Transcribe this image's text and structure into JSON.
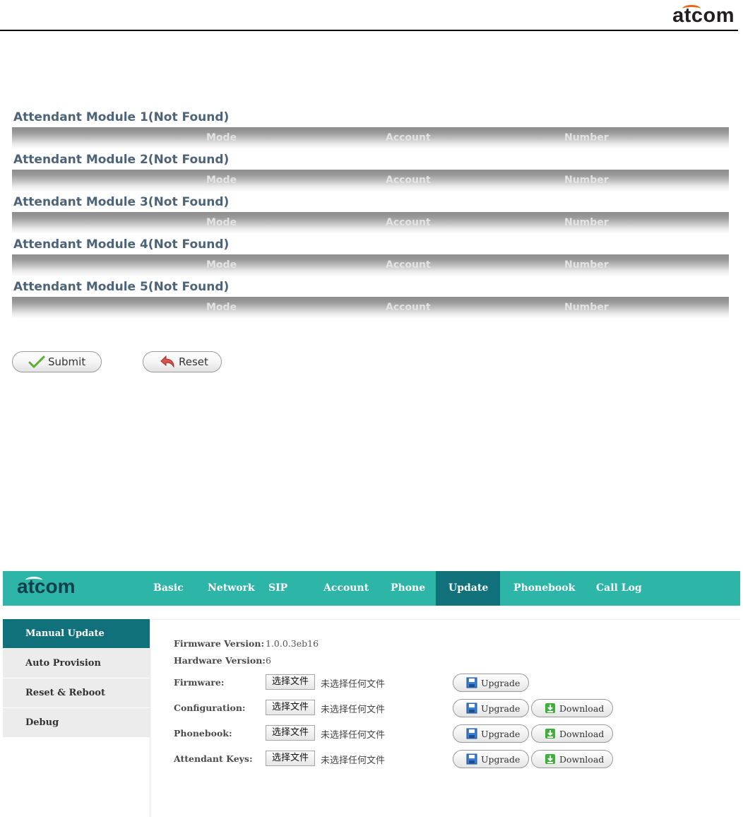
{
  "document": {
    "logo": "atcom"
  },
  "modules": [
    {
      "title": "Attendant Module 1(Not Found)"
    },
    {
      "title": "Attendant Module 2(Not Found)"
    },
    {
      "title": "Attendant Module 3(Not Found)"
    },
    {
      "title": "Attendant Module 4(Not Found)"
    },
    {
      "title": "Attendant Module 5(Not Found)"
    }
  ],
  "module_columns": {
    "mode": "Mode",
    "account": "Account",
    "number": "Number"
  },
  "form_buttons": {
    "submit": "Submit",
    "reset": "Reset"
  },
  "ui": {
    "logo": "atcom",
    "nav": [
      "Basic",
      "Network",
      "SIP",
      "Account",
      "Phone",
      "Update",
      "Phonebook",
      "Call Log"
    ],
    "active_nav": "Update",
    "sidebar": [
      "Manual Update",
      "Auto Provision",
      "Reset & Reboot",
      "Debug"
    ],
    "active_sidebar": "Manual Update",
    "firmware_version_label": "Firmware Version:",
    "firmware_version_value": "1.0.0.3eb16",
    "hardware_version_label": "Hardware Version:",
    "hardware_version_value": "6",
    "rows": [
      {
        "label": "Firmware:",
        "choose": "选择文件",
        "nofile": "未选择任何文件",
        "upgrade": "Upgrade"
      },
      {
        "label": "Configuration:",
        "choose": "选择文件",
        "nofile": "未选择任何文件",
        "upgrade": "Upgrade",
        "download": "Download"
      },
      {
        "label": "Phonebook:",
        "choose": "选择文件",
        "nofile": "未选择任何文件",
        "upgrade": "Upgrade",
        "download": "Download"
      },
      {
        "label": "Attendant Keys:",
        "choose": "选择文件",
        "nofile": "未选择任何文件",
        "upgrade": "Upgrade",
        "download": "Download"
      }
    ],
    "colors": {
      "nav_bg": "#2db5a8",
      "active_bg": "#11717b",
      "sidebar_bg": "#ececec"
    }
  }
}
